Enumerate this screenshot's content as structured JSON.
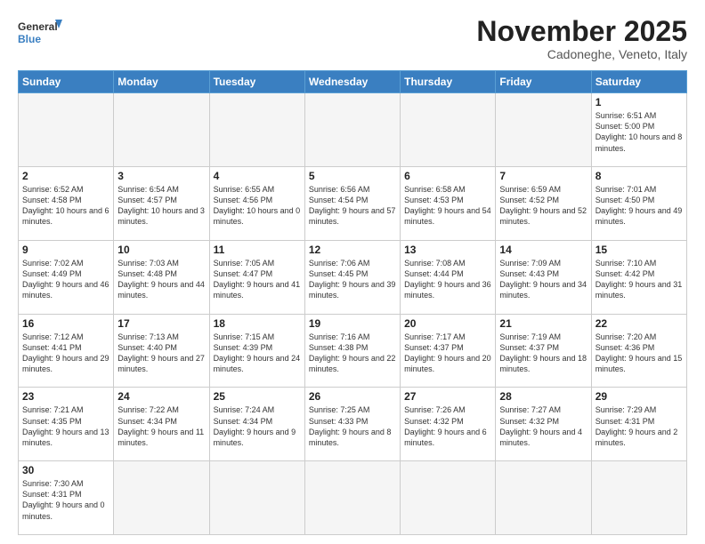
{
  "logo": {
    "text_general": "General",
    "text_blue": "Blue"
  },
  "header": {
    "month_title": "November 2025",
    "location": "Cadoneghe, Veneto, Italy"
  },
  "weekdays": [
    "Sunday",
    "Monday",
    "Tuesday",
    "Wednesday",
    "Thursday",
    "Friday",
    "Saturday"
  ],
  "weeks": [
    [
      {
        "day": "",
        "info": "",
        "empty": true
      },
      {
        "day": "",
        "info": "",
        "empty": true
      },
      {
        "day": "",
        "info": "",
        "empty": true
      },
      {
        "day": "",
        "info": "",
        "empty": true
      },
      {
        "day": "",
        "info": "",
        "empty": true
      },
      {
        "day": "",
        "info": "",
        "empty": true
      },
      {
        "day": "1",
        "info": "Sunrise: 6:51 AM\nSunset: 5:00 PM\nDaylight: 10 hours\nand 8 minutes."
      }
    ],
    [
      {
        "day": "2",
        "info": "Sunrise: 6:52 AM\nSunset: 4:58 PM\nDaylight: 10 hours\nand 6 minutes."
      },
      {
        "day": "3",
        "info": "Sunrise: 6:54 AM\nSunset: 4:57 PM\nDaylight: 10 hours\nand 3 minutes."
      },
      {
        "day": "4",
        "info": "Sunrise: 6:55 AM\nSunset: 4:56 PM\nDaylight: 10 hours\nand 0 minutes."
      },
      {
        "day": "5",
        "info": "Sunrise: 6:56 AM\nSunset: 4:54 PM\nDaylight: 9 hours\nand 57 minutes."
      },
      {
        "day": "6",
        "info": "Sunrise: 6:58 AM\nSunset: 4:53 PM\nDaylight: 9 hours\nand 54 minutes."
      },
      {
        "day": "7",
        "info": "Sunrise: 6:59 AM\nSunset: 4:52 PM\nDaylight: 9 hours\nand 52 minutes."
      },
      {
        "day": "8",
        "info": "Sunrise: 7:01 AM\nSunset: 4:50 PM\nDaylight: 9 hours\nand 49 minutes."
      }
    ],
    [
      {
        "day": "9",
        "info": "Sunrise: 7:02 AM\nSunset: 4:49 PM\nDaylight: 9 hours\nand 46 minutes."
      },
      {
        "day": "10",
        "info": "Sunrise: 7:03 AM\nSunset: 4:48 PM\nDaylight: 9 hours\nand 44 minutes."
      },
      {
        "day": "11",
        "info": "Sunrise: 7:05 AM\nSunset: 4:47 PM\nDaylight: 9 hours\nand 41 minutes."
      },
      {
        "day": "12",
        "info": "Sunrise: 7:06 AM\nSunset: 4:45 PM\nDaylight: 9 hours\nand 39 minutes."
      },
      {
        "day": "13",
        "info": "Sunrise: 7:08 AM\nSunset: 4:44 PM\nDaylight: 9 hours\nand 36 minutes."
      },
      {
        "day": "14",
        "info": "Sunrise: 7:09 AM\nSunset: 4:43 PM\nDaylight: 9 hours\nand 34 minutes."
      },
      {
        "day": "15",
        "info": "Sunrise: 7:10 AM\nSunset: 4:42 PM\nDaylight: 9 hours\nand 31 minutes."
      }
    ],
    [
      {
        "day": "16",
        "info": "Sunrise: 7:12 AM\nSunset: 4:41 PM\nDaylight: 9 hours\nand 29 minutes."
      },
      {
        "day": "17",
        "info": "Sunrise: 7:13 AM\nSunset: 4:40 PM\nDaylight: 9 hours\nand 27 minutes."
      },
      {
        "day": "18",
        "info": "Sunrise: 7:15 AM\nSunset: 4:39 PM\nDaylight: 9 hours\nand 24 minutes."
      },
      {
        "day": "19",
        "info": "Sunrise: 7:16 AM\nSunset: 4:38 PM\nDaylight: 9 hours\nand 22 minutes."
      },
      {
        "day": "20",
        "info": "Sunrise: 7:17 AM\nSunset: 4:37 PM\nDaylight: 9 hours\nand 20 minutes."
      },
      {
        "day": "21",
        "info": "Sunrise: 7:19 AM\nSunset: 4:37 PM\nDaylight: 9 hours\nand 18 minutes."
      },
      {
        "day": "22",
        "info": "Sunrise: 7:20 AM\nSunset: 4:36 PM\nDaylight: 9 hours\nand 15 minutes."
      }
    ],
    [
      {
        "day": "23",
        "info": "Sunrise: 7:21 AM\nSunset: 4:35 PM\nDaylight: 9 hours\nand 13 minutes."
      },
      {
        "day": "24",
        "info": "Sunrise: 7:22 AM\nSunset: 4:34 PM\nDaylight: 9 hours\nand 11 minutes."
      },
      {
        "day": "25",
        "info": "Sunrise: 7:24 AM\nSunset: 4:34 PM\nDaylight: 9 hours\nand 9 minutes."
      },
      {
        "day": "26",
        "info": "Sunrise: 7:25 AM\nSunset: 4:33 PM\nDaylight: 9 hours\nand 8 minutes."
      },
      {
        "day": "27",
        "info": "Sunrise: 7:26 AM\nSunset: 4:32 PM\nDaylight: 9 hours\nand 6 minutes."
      },
      {
        "day": "28",
        "info": "Sunrise: 7:27 AM\nSunset: 4:32 PM\nDaylight: 9 hours\nand 4 minutes."
      },
      {
        "day": "29",
        "info": "Sunrise: 7:29 AM\nSunset: 4:31 PM\nDaylight: 9 hours\nand 2 minutes."
      }
    ],
    [
      {
        "day": "30",
        "info": "Sunrise: 7:30 AM\nSunset: 4:31 PM\nDaylight: 9 hours\nand 0 minutes."
      },
      {
        "day": "",
        "info": "",
        "empty": true
      },
      {
        "day": "",
        "info": "",
        "empty": true
      },
      {
        "day": "",
        "info": "",
        "empty": true
      },
      {
        "day": "",
        "info": "",
        "empty": true
      },
      {
        "day": "",
        "info": "",
        "empty": true
      },
      {
        "day": "",
        "info": "",
        "empty": true
      }
    ]
  ]
}
